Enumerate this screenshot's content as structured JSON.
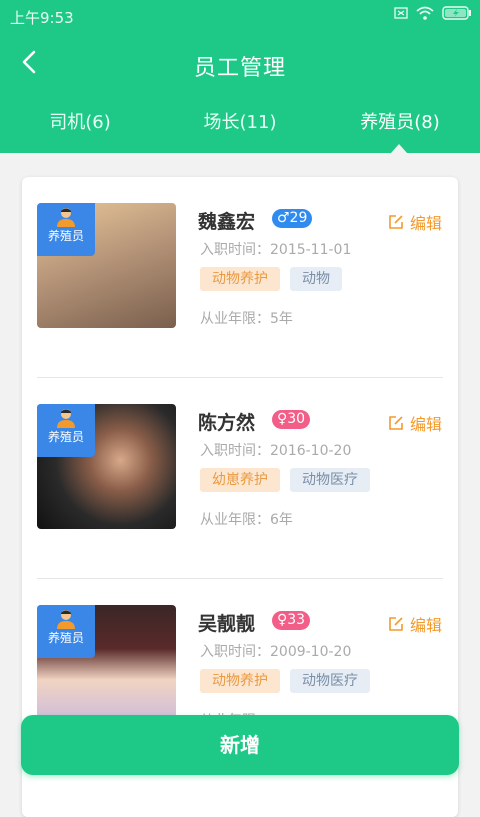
{
  "status_bar": {
    "time": "上午9:53"
  },
  "header": {
    "title": "员工管理"
  },
  "tabs": [
    {
      "label": "司机(6)",
      "active": false
    },
    {
      "label": "场长(11)",
      "active": false
    },
    {
      "label": "养殖员(8)",
      "active": true
    }
  ],
  "employees": [
    {
      "role": "养殖员",
      "name": "魏鑫宏",
      "gender": "male",
      "age": "♂29",
      "hire_date": "入职时间：2015-11-01",
      "tags": [
        "动物养护",
        "动物"
      ],
      "years": "从业年限：5年",
      "edit_label": "编辑",
      "photo_colors": [
        "#e9c89a",
        "#7a5f4d"
      ]
    },
    {
      "role": "养殖员",
      "name": "陈方然",
      "gender": "female",
      "age": "♀30",
      "hire_date": "入职时间：2016-10-20",
      "tags": [
        "幼崽养护",
        "动物医疗"
      ],
      "years": "从业年限：6年",
      "edit_label": "编辑",
      "photo_colors": [
        "#2a2a2a",
        "#d8a98a"
      ]
    },
    {
      "role": "养殖员",
      "name": "吴靓靓",
      "gender": "female",
      "age": "♀33",
      "hire_date": "入职时间：2009-10-20",
      "tags": [
        "动物养护",
        "动物医疗"
      ],
      "years": "从业年限：",
      "edit_label": "编辑",
      "photo_colors": [
        "#3b2626",
        "#f1d4c2"
      ]
    }
  ],
  "add_button": {
    "label": "新增"
  },
  "colors": {
    "primary": "#1ec987",
    "role_tag": "#3b87e8",
    "edit": "#f39a2c"
  }
}
